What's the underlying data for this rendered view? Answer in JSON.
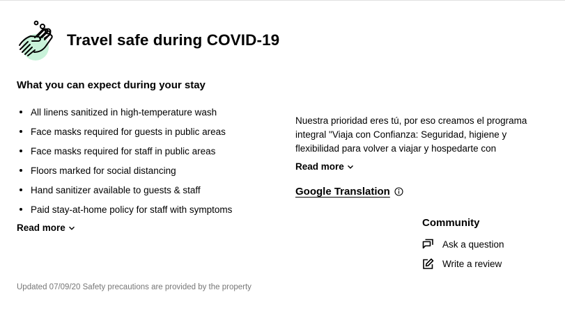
{
  "header": {
    "title": "Travel safe during COVID-19",
    "icon": "hand-washing-icon",
    "accent_color": "#c8f2d9"
  },
  "precautions": {
    "title": "What you can expect during your stay",
    "items": [
      "All linens sanitized in high-temperature wash",
      "Face masks required for guests in public areas",
      "Face masks required for staff in public areas",
      "Floors marked for social distancing",
      "Hand sanitizer available to guests & staff",
      "Paid stay-at-home policy for staff with symptoms"
    ],
    "read_more_label": "Read more"
  },
  "property_statement": {
    "text": "Nuestra prioridad eres tú, por eso creamos el programa integral \"Viaja con Confianza: Seguridad, higiene y flexibilidad para volver a viajar y hospedarte con",
    "read_more_label": "Read more",
    "translation_label": "Google Translation"
  },
  "community": {
    "title": "Community",
    "ask_label": "Ask a question",
    "review_label": "Write a review"
  },
  "footer": {
    "text": "Updated 07/09/20 Safety precautions are provided by the property"
  }
}
